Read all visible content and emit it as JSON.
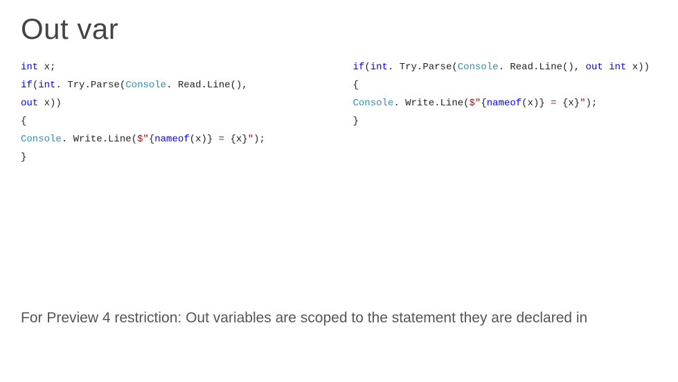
{
  "title": "Out var",
  "code_left": {
    "l1_kw": "int",
    "l1_rest": " x;",
    "l2_pre": "            ",
    "l2_kw1": "if",
    "l2_p1": "(",
    "l2_kw2": "int",
    "l2_p2": ". Try.Parse(",
    "l2_typ": "Console",
    "l2_p3": ". Read.Line(), ",
    "l3_kw": "out",
    "l3_rest": " x))",
    "l4": "{",
    "l5_pre": "   ",
    "l5_typ": "Console",
    "l5_p1": ". Write.Line(",
    "l5_str1": "$\"",
    "l5_p2": "{",
    "l5_kw": "nameof",
    "l5_p3": "(x)}",
    "l5_str2": " = ",
    "l5_p4": "{x}",
    "l5_str3": "\"",
    "l5_p5": ");",
    "l6": "}"
  },
  "code_right": {
    "l1_kw1": "if",
    "l1_p1": "(",
    "l1_kw2": "int",
    "l1_p2": ". Try.Parse(",
    "l1_typ": "Console",
    "l1_p3": ". Read.Line(), ",
    "l1_kw3": "out int",
    "l1_p4": " x))",
    "l2": "{",
    "l3_pre": "   ",
    "l3_typ": "Console",
    "l3_p1": ". Write.Line(",
    "l3_str1": "$\"",
    "l3_p2": "{",
    "l3_kw": "nameof",
    "l3_p3": "(x)}",
    "l3_str2": " = ",
    "l3_p4": "{x}",
    "l3_str3": "\"",
    "l3_p5": ");",
    "l4": "}"
  },
  "footer": "For Preview 4 restriction: Out variables are scoped to the statement they are declared in"
}
